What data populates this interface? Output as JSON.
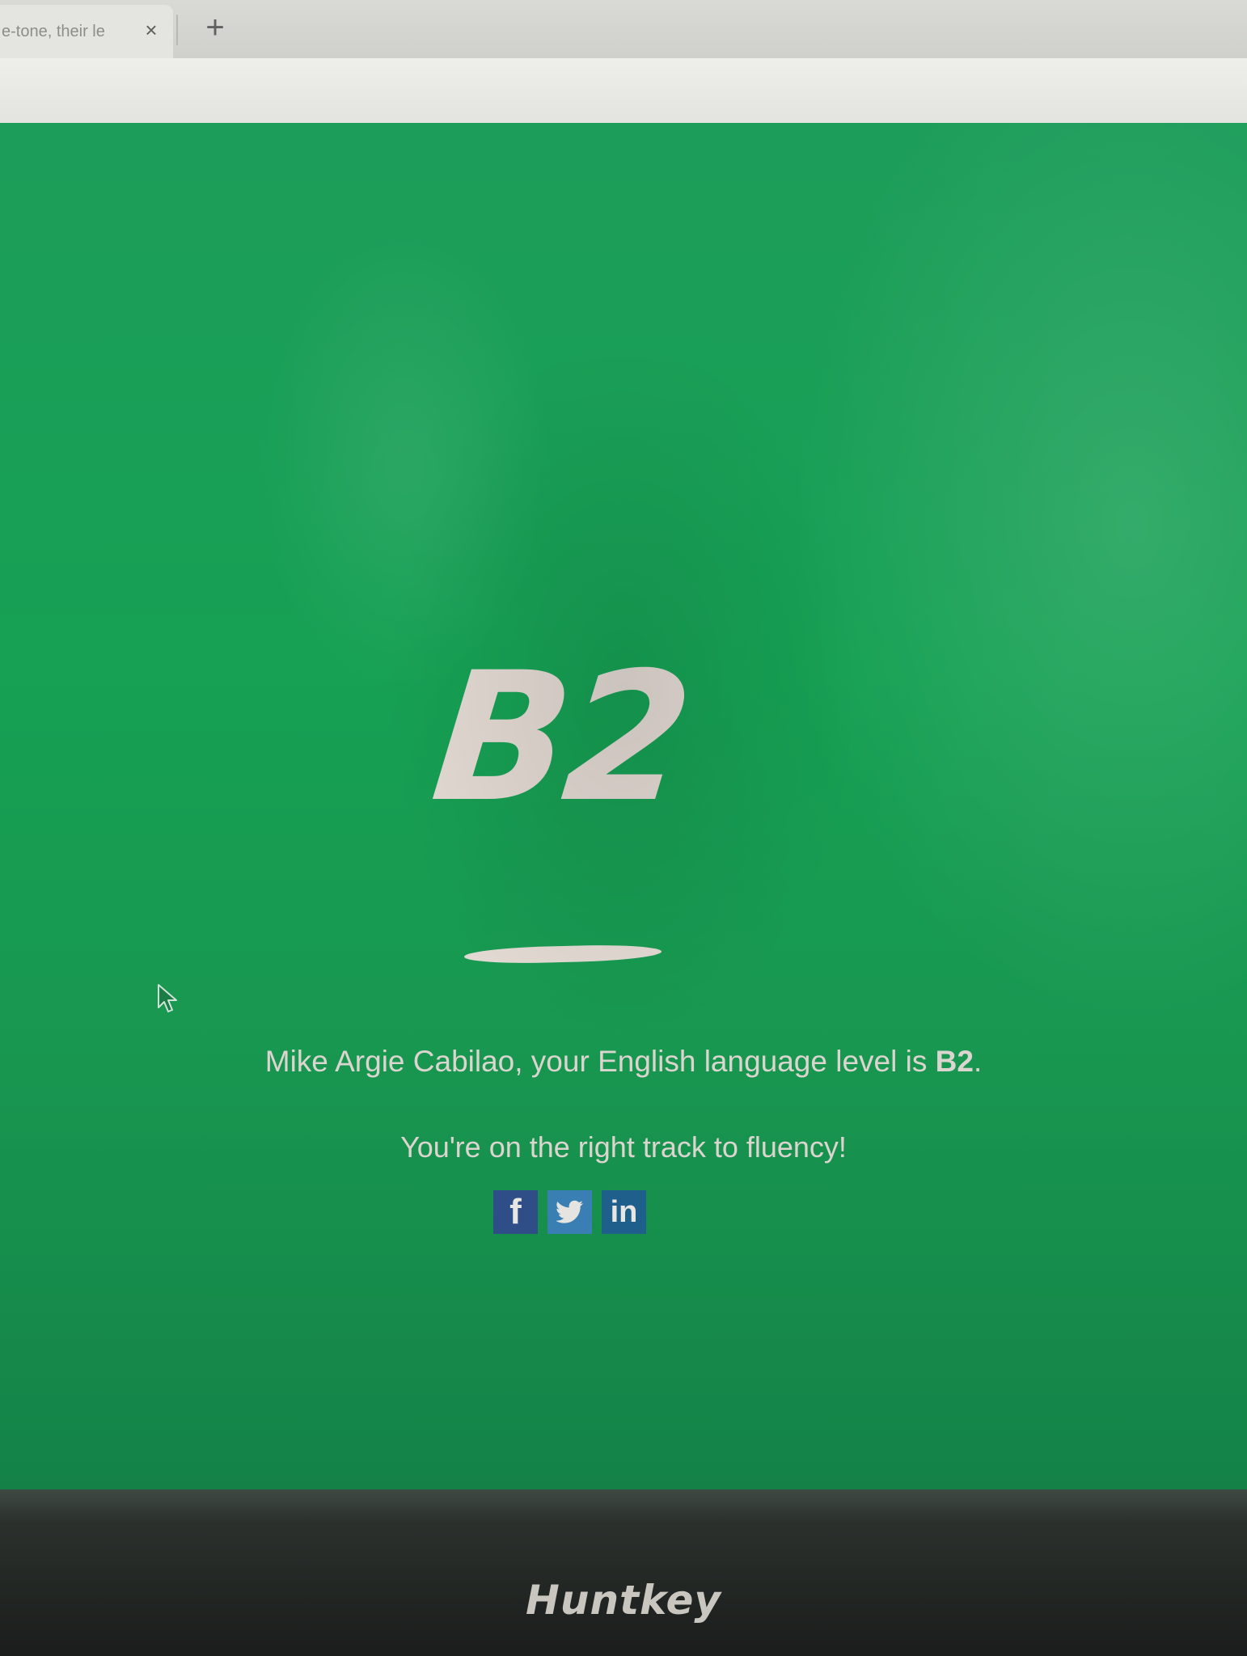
{
  "browser": {
    "tab_title": "e-tone, their le",
    "tab_close_label": "×",
    "new_tab_label": "+"
  },
  "result": {
    "level_badge": "B2",
    "name_and_phrase": "Mike Argie Cabilao, your English language level is ",
    "level_bold": "B2",
    "period": ".",
    "encouragement": "You're on the right track to fluency!"
  },
  "share": {
    "facebook_label": "f",
    "twitter_icon": "twitter-bird-icon",
    "linkedin_label": "in"
  },
  "monitor": {
    "brand": "Huntkey"
  },
  "colors": {
    "page_background": "#16a154",
    "text": "#dcd5cf",
    "facebook": "#2f4d86",
    "twitter": "#3a7fb3",
    "linkedin": "#1f5f8c"
  }
}
